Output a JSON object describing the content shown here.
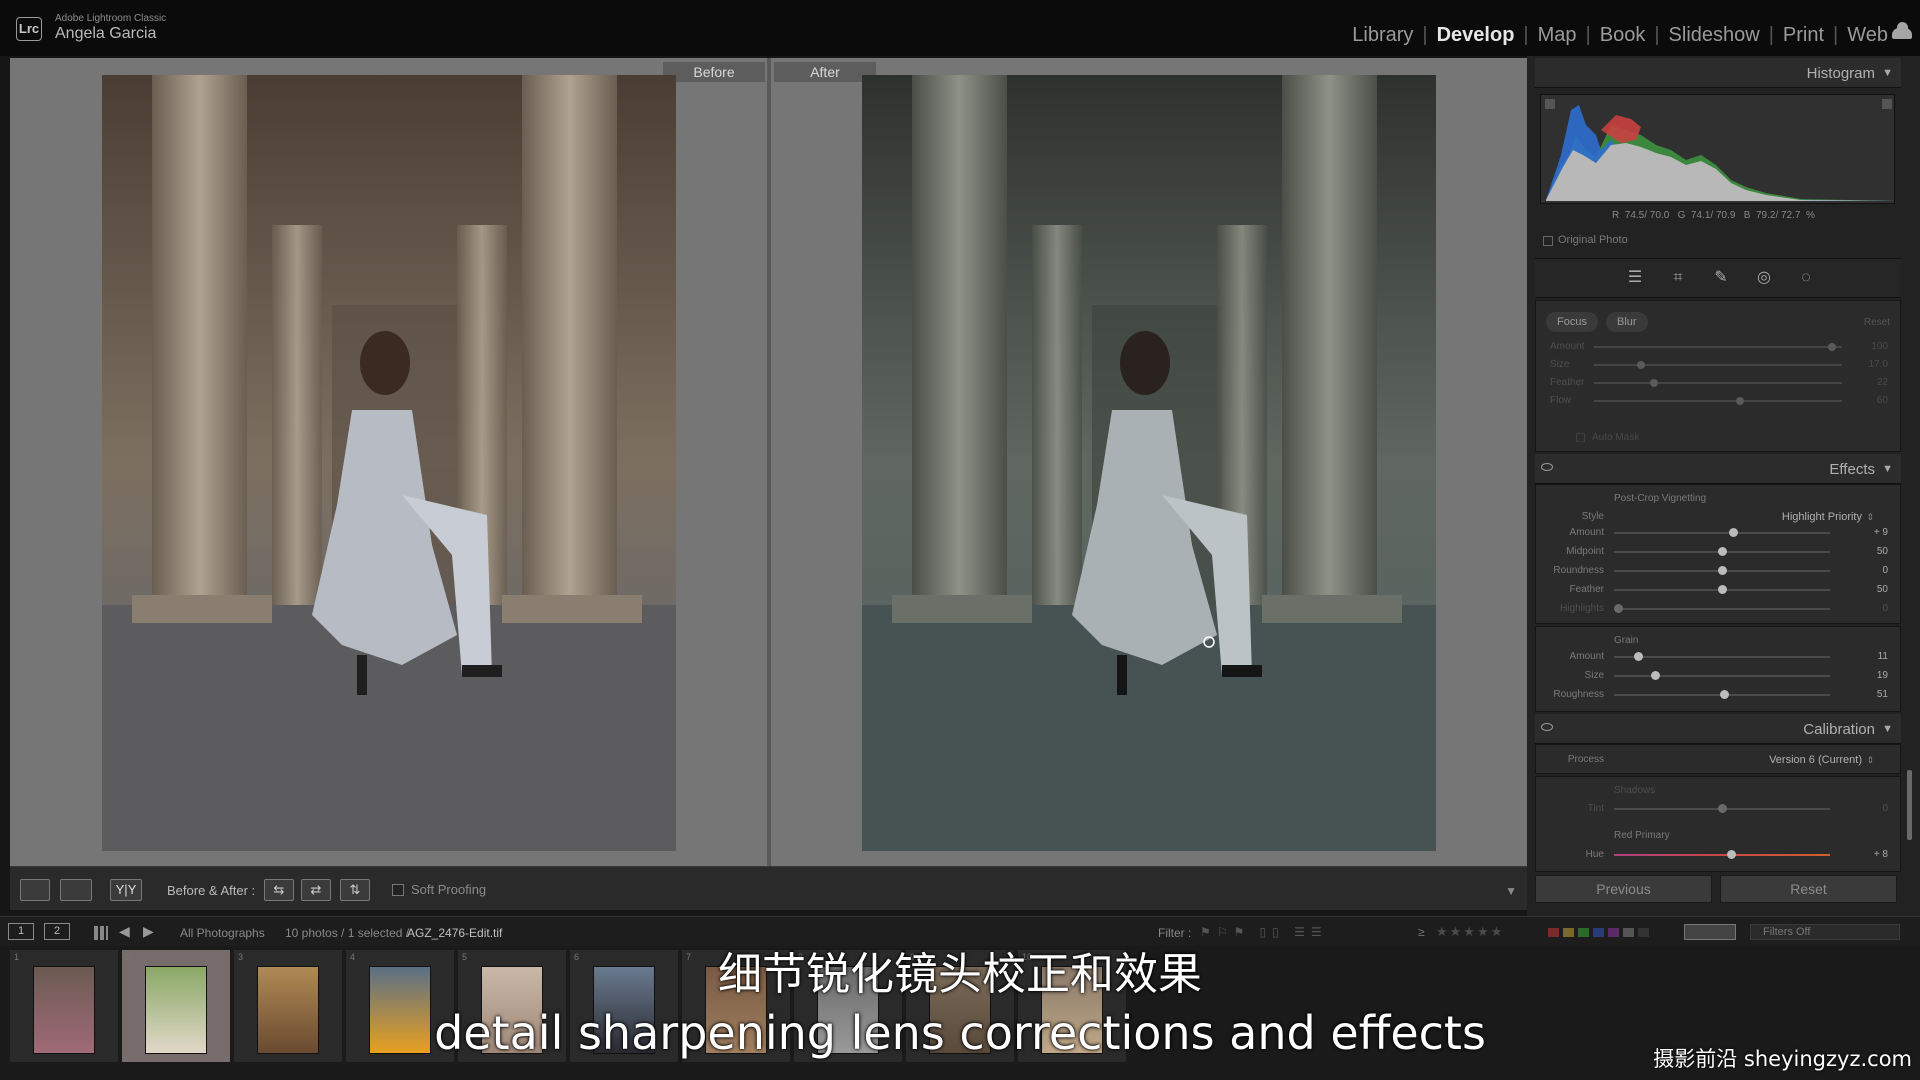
{
  "app": {
    "name": "Adobe Lightroom Classic",
    "user": "Angela Garcia",
    "logo": "Lrc"
  },
  "modules": [
    "Library",
    "Develop",
    "Map",
    "Book",
    "Slideshow",
    "Print",
    "Web"
  ],
  "active_module": "Develop",
  "compare": {
    "before_label": "Before",
    "after_label": "After"
  },
  "toolbar": {
    "before_after_label": "Before & After :",
    "soft_proofing_label": "Soft Proofing",
    "compare_icon_text": "Y|Y",
    "swap_icons": [
      "⇆",
      "⇄",
      "⇅"
    ]
  },
  "histogram": {
    "title": "Histogram",
    "readout": "R  74.5/ 70.0   G  74.1/ 70.9   B  79.2/ 72.7  %",
    "original_photo_label": "Original Photo"
  },
  "mask": {
    "chips": [
      "Focus",
      "Blur"
    ],
    "reset_label": "Reset",
    "sliders": [
      {
        "label": "Amount",
        "value": "100",
        "pos": 0.96
      },
      {
        "label": "Size",
        "value": "17.0",
        "pos": 0.19
      },
      {
        "label": "Feather",
        "value": "22",
        "pos": 0.24
      },
      {
        "label": "Flow",
        "value": "60",
        "pos": 0.59
      }
    ],
    "auto_mask_label": "Auto Mask"
  },
  "effects": {
    "title": "Effects",
    "vignette_title": "Post-Crop Vignetting",
    "style_label": "Style",
    "style_value": "Highlight Priority",
    "sliders": [
      {
        "label": "Amount",
        "value": "+ 9",
        "pos": 0.55,
        "dim": false
      },
      {
        "label": "Midpoint",
        "value": "50",
        "pos": 0.5,
        "dim": false
      },
      {
        "label": "Roundness",
        "value": "0",
        "pos": 0.5,
        "dim": false
      },
      {
        "label": "Feather",
        "value": "50",
        "pos": 0.5,
        "dim": false
      },
      {
        "label": "Highlights",
        "value": "0",
        "pos": 0.02,
        "dim": true
      }
    ],
    "grain_title": "Grain",
    "grain_sliders": [
      {
        "label": "Amount",
        "value": "11",
        "pos": 0.11
      },
      {
        "label": "Size",
        "value": "19",
        "pos": 0.19
      },
      {
        "label": "Roughness",
        "value": "51",
        "pos": 0.51
      }
    ]
  },
  "calibration": {
    "title": "Calibration",
    "process_label": "Process",
    "process_value": "Version 6 (Current)",
    "shadows_title": "Shadows",
    "tint_label": "Tint",
    "tint_value": "0",
    "tint_pos": 0.5,
    "red_primary_title": "Red Primary",
    "hue_label": "Hue",
    "hue_value": "+ 8",
    "hue_pos": 0.54
  },
  "buttons": {
    "previous": "Previous",
    "reset": "Reset"
  },
  "filmstrip_bar": {
    "secondary_1": "1",
    "secondary_2": "2",
    "source": "All Photographs",
    "selection": "10 photos / 1 selected /",
    "filename": "AGZ_2476-Edit.tif",
    "filter_label": "Filter :",
    "filters_off": "Filters Off"
  },
  "filmstrip": {
    "thumbs": [
      {
        "num": "1",
        "top": "#6b5a52",
        "bottom": "#a06a78"
      },
      {
        "num": "2",
        "top": "#8aa866",
        "bottom": "#e0d8c8",
        "selected": true
      },
      {
        "num": "3",
        "top": "#b08a54",
        "bottom": "#6a4a30"
      },
      {
        "num": "4",
        "top": "#5a6f86",
        "bottom": "#e8a020"
      },
      {
        "num": "5",
        "top": "#c8b8a8",
        "bottom": "#a08878"
      },
      {
        "num": "6",
        "top": "#6a7a90",
        "bottom": "#2a2a30"
      },
      {
        "num": "7",
        "top": "#7a5a42",
        "bottom": "#a08060"
      },
      {
        "num": "8",
        "top": "#6a6a6a",
        "bottom": "#9a9a9a"
      },
      {
        "num": "9",
        "top": "#7a6a5a",
        "bottom": "#5a4a3a"
      },
      {
        "num": "10",
        "top": "#8a7a6a",
        "bottom": "#c0a888"
      }
    ]
  },
  "subtitles": {
    "chinese": "细节锐化镜头校正和效果",
    "english": "detail sharpening lens corrections and effects"
  },
  "watermark": "摄影前沿 sheyingzyz.com",
  "colors": {
    "accent": "#e6e6e6",
    "panel": "#2b2b2b",
    "workarea": "#767676"
  }
}
